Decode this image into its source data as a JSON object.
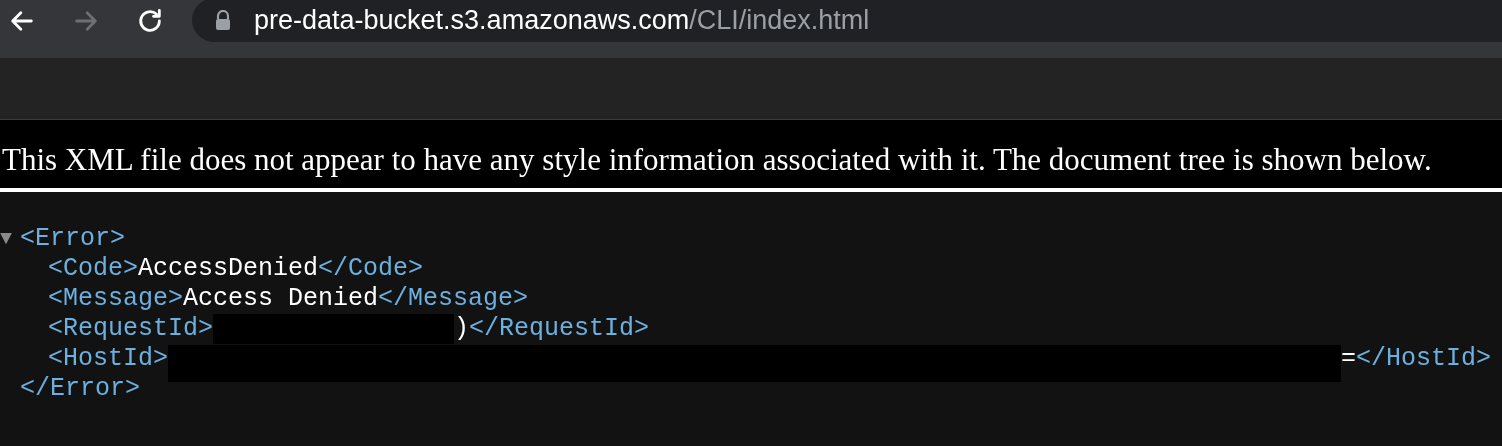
{
  "toolbar": {
    "buttons": [
      {
        "kind": "back",
        "disabled": false
      },
      {
        "kind": "forward",
        "disabled": true
      },
      {
        "kind": "reload",
        "disabled": false
      }
    ],
    "address": {
      "host": "pre-data-bucket.s3.amazonaws.com",
      "path": "/CLI/index.html"
    }
  },
  "notice": "This XML file does not appear to have any style information associated with it. The document tree is shown below.",
  "tree": {
    "toggle": "▼",
    "expanded": true,
    "open_tag": "<Error>",
    "close_tag": "</Error>",
    "children": [
      {
        "kind": "plain",
        "open_tag": "<Code>",
        "value": "AccessDenied",
        "close_tag": "</Code>"
      },
      {
        "kind": "plain",
        "open_tag": "<Message>",
        "value": "Access Denied",
        "close_tag": "</Message>"
      },
      {
        "kind": "redacted",
        "open_tag": "<RequestId>",
        "value": ")",
        "close_tag": "</RequestId>"
      },
      {
        "kind": "redactedwide",
        "open_tag": "<HostId>",
        "value": "=",
        "close_tag": "</HostId>"
      }
    ]
  }
}
